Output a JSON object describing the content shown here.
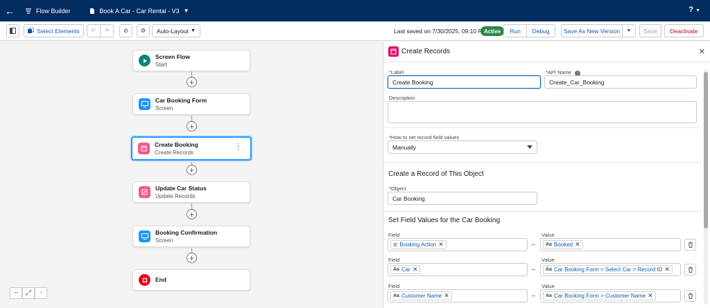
{
  "topbar": {
    "app_name": "Flow Builder",
    "flow_name": "Book A Car - Car Rental - V3",
    "help": "?"
  },
  "toolbar": {
    "select_elements": "Select Elements",
    "layout": "Auto-Layout",
    "last_saved": "Last saved on 7/30/2025, 09:10 PM",
    "status": "Active",
    "run": "Run",
    "debug": "Debug",
    "save_as_new_version": "Save As New Version",
    "save": "Save",
    "deactivate": "Deactivate"
  },
  "canvas": {
    "nodes": [
      {
        "title": "Screen Flow",
        "subtitle": "Start",
        "icon": "play-icon",
        "color": "#0b827c"
      },
      {
        "title": "Car Booking Form",
        "subtitle": "Screen",
        "icon": "screen-icon",
        "color": "#1b96ff"
      },
      {
        "title": "Create Booking",
        "subtitle": "Create Records",
        "icon": "create-record-icon",
        "color": "#f0598f"
      },
      {
        "title": "Update Car Status",
        "subtitle": "Update Records",
        "icon": "update-record-icon",
        "color": "#f0598f"
      },
      {
        "title": "Booking Confirmation",
        "subtitle": "Screen",
        "icon": "screen-icon",
        "color": "#1b96ff"
      },
      {
        "title": "End",
        "subtitle": "",
        "icon": "stop-icon",
        "color": "#ea001e"
      }
    ],
    "zoom": {
      "out": "−",
      "fit": "⤢",
      "in": "+"
    }
  },
  "panel": {
    "title": "Create Records",
    "label_label": "Label",
    "label_value": "Create Booking",
    "api_name_label": "API Name",
    "api_name_value": "Create_Car_Booking",
    "description_label": "Description",
    "how_to_set_label": "How to set record field values",
    "how_to_set_value": "Manually",
    "section_object": "Create a Record of This Object",
    "object_label": "Object",
    "object_value": "Car Booking",
    "section_fields": "Set Field Values for the Car Booking",
    "field_label": "Field",
    "value_label": "Value",
    "rows": [
      {
        "field": "Booking Action",
        "field_icon": "picklist-icon",
        "value": "Booked",
        "value_icon": "text-icon"
      },
      {
        "field": "Car",
        "field_icon": "text-icon",
        "value": "Car Booking Form > Select Car > Record ID",
        "value_icon": "text-icon"
      },
      {
        "field": "Customer Name",
        "field_icon": "text-icon",
        "value": "Car Booking Form > Customer Name",
        "value_icon": "text-icon"
      }
    ]
  }
}
